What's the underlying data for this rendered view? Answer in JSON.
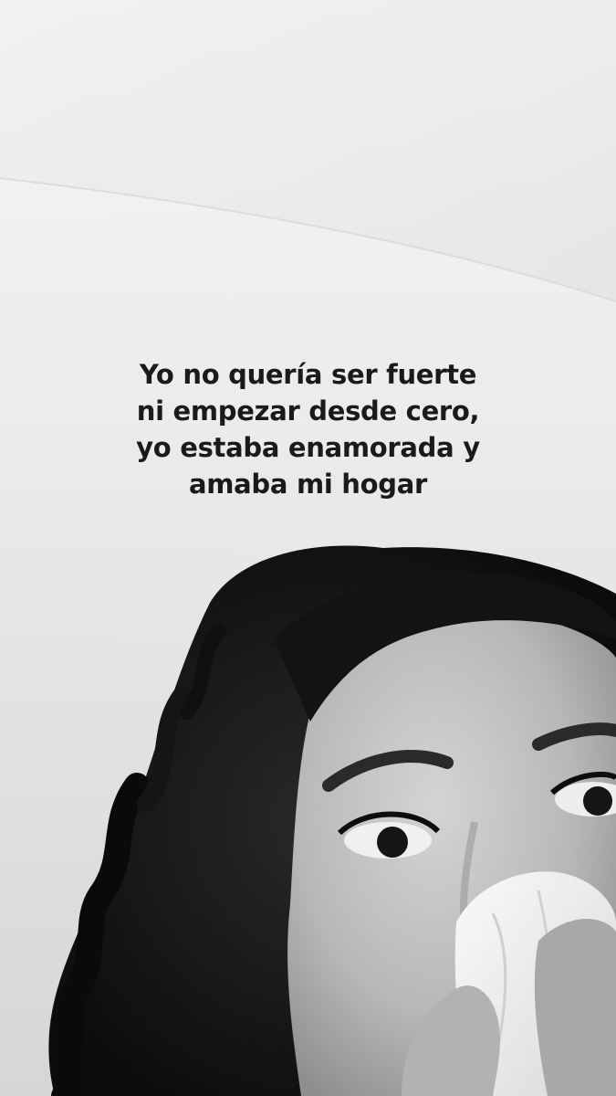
{
  "caption": {
    "lines": [
      "Yo no quería ser fuerte",
      "ni empezar desde cero,",
      "yo estaba enamorada y",
      "amaba mi hogar"
    ]
  },
  "photo": {
    "style": "black-and-white selfie",
    "subject": "woman with dark curly hair crying, holding a white tissue to her nose",
    "background_color": "#e9e9e9",
    "hair_color": "#141414",
    "skin_tone": "#bdbdbd"
  }
}
